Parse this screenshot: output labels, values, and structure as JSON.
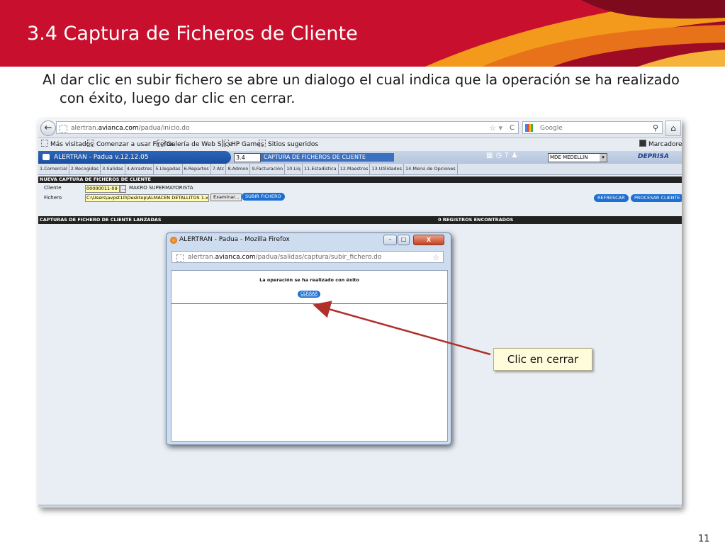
{
  "slide": {
    "title": "3.4 Captura de Ficheros de Cliente",
    "text": "Al dar clic en subir fichero se abre un dialogo el cual indica que la operación se ha realizado con éxito, luego dar clic en cerrar.",
    "page_number": "11",
    "colors": {
      "banner": "#c8102e",
      "banner_accent": "#f39a1c"
    }
  },
  "browser": {
    "url_prefix": "alertran.",
    "url_domain": "avianca.com",
    "url_path": "/padua/inicio.do",
    "search_placeholder": "Google",
    "bookmarks": [
      "Más visitados",
      "Comenzar a usar Firefox",
      "Galería de Web Slice",
      "HP Games",
      "Sitios sugeridos"
    ],
    "bookmarks_right": "Marcadores"
  },
  "app": {
    "title": "ALERTRAN - Padua  v.12.12.05",
    "code": "3.4",
    "module": "CAPTURA DE FICHEROS DE CLIENTE",
    "site": "MDE MEDELLIN",
    "logo": "DEPRISA",
    "menu": [
      "1.Comercial",
      "2.Recogidas",
      "3.Salidas",
      "4.Arrastres",
      "5.Llegadas",
      "6.Repartos",
      "7.Atc",
      "8.Admon",
      "9.Facturación",
      "10.Liq",
      "11.Estadística",
      "12.Maestros",
      "13.Utilidades",
      "14.Menú de Opciones"
    ],
    "section_new": "NUEVA CAPTURA DE FICHEROS DE CLIENTE",
    "cliente_label": "Cliente",
    "cliente_code": "00000011-09",
    "cliente_name": "MAKRO SUPERMAYORISTA",
    "fichero_label": "Fichero",
    "fichero_path": "C:\\Users\\avpst10\\Desktop\\ALMACEN DETALLITOS 1.xls",
    "examinar": "Examinar...",
    "subir": "SUBIR FICHERO",
    "refrescar": "REFRESCAR",
    "procesar": "PROCESAR CLIENTE",
    "section_list": "CAPTURAS DE FICHERO DE CLIENTE LANZADAS",
    "records": "0 REGISTROS ENCONTRADOS"
  },
  "popup": {
    "title": "ALERTRAN - Padua - Mozilla Firefox",
    "url_prefix": "alertran.",
    "url_domain": "avianca.com",
    "url_path": "/padua/salidas/captura/subir_fichero.do",
    "message": "La operación se ha realizado con éxito",
    "close_button": "CERRAR"
  },
  "callout": {
    "text": "Clic en cerrar",
    "arrow_color": "#b0302a"
  }
}
